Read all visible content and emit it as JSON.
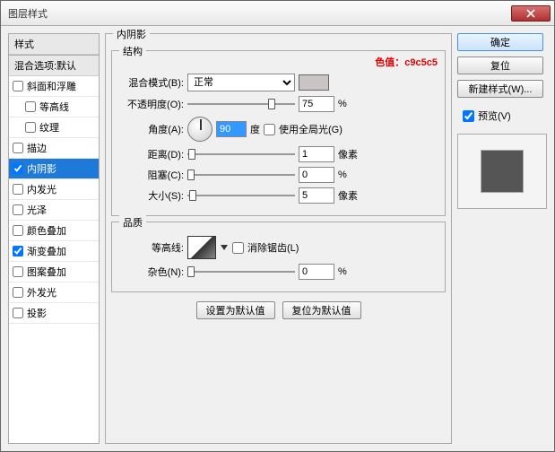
{
  "window": {
    "title": "图层样式"
  },
  "annotation": "色值：c9c5c5",
  "sidebar": {
    "heading_styles": "样式",
    "heading_blend": "混合选项:默认",
    "items": [
      {
        "label": "斜面和浮雕",
        "checked": false,
        "sub": false
      },
      {
        "label": "等高线",
        "checked": false,
        "sub": true
      },
      {
        "label": "纹理",
        "checked": false,
        "sub": true
      },
      {
        "label": "描边",
        "checked": false,
        "sub": false
      },
      {
        "label": "内阴影",
        "checked": true,
        "sub": false,
        "selected": true
      },
      {
        "label": "内发光",
        "checked": false,
        "sub": false
      },
      {
        "label": "光泽",
        "checked": false,
        "sub": false
      },
      {
        "label": "颜色叠加",
        "checked": false,
        "sub": false
      },
      {
        "label": "渐变叠加",
        "checked": true,
        "sub": false
      },
      {
        "label": "图案叠加",
        "checked": false,
        "sub": false
      },
      {
        "label": "外发光",
        "checked": false,
        "sub": false
      },
      {
        "label": "投影",
        "checked": false,
        "sub": false
      }
    ]
  },
  "main": {
    "section_title": "内阴影",
    "structure": {
      "legend": "结构",
      "blend_label": "混合模式(B):",
      "blend_value": "正常",
      "swatch": "#c9c5c5",
      "opacity_label": "不透明度(O):",
      "opacity_value": "75",
      "opacity_unit": "%",
      "angle_label": "角度(A):",
      "angle_value": "90",
      "angle_unit": "度",
      "global_light_label": "使用全局光(G)",
      "global_light_checked": false,
      "distance_label": "距离(D):",
      "distance_value": "1",
      "distance_unit": "像素",
      "choke_label": "阻塞(C):",
      "choke_value": "0",
      "choke_unit": "%",
      "size_label": "大小(S):",
      "size_value": "5",
      "size_unit": "像素"
    },
    "quality": {
      "legend": "品质",
      "contour_label": "等高线:",
      "antialias_label": "消除锯齿(L)",
      "antialias_checked": false,
      "noise_label": "杂色(N):",
      "noise_value": "0",
      "noise_unit": "%"
    },
    "buttons": {
      "make_default": "设置为默认值",
      "reset_default": "复位为默认值"
    }
  },
  "right": {
    "ok": "确定",
    "reset": "复位",
    "new_style": "新建样式(W)...",
    "preview_label": "预览(V)",
    "preview_checked": true
  }
}
